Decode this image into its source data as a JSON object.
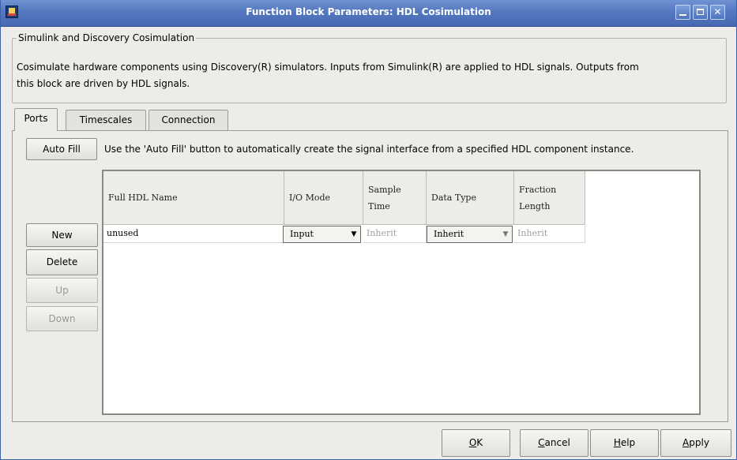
{
  "window": {
    "title": "Function Block Parameters: HDL Cosimulation",
    "icon": "matlab-app-icon",
    "controls": [
      "minimize-icon",
      "maximize-icon",
      "close-icon"
    ]
  },
  "group": {
    "title": "Simulink and Discovery Cosimulation",
    "description_line1": "Cosimulate hardware components using Discovery(R) simulators. Inputs from Simulink(R) are applied to HDL signals. Outputs from",
    "description_line2": "this block are driven by HDL signals."
  },
  "tabs": [
    {
      "label": "Ports",
      "active": true
    },
    {
      "label": "Timescales",
      "active": false
    },
    {
      "label": "Connection",
      "active": false
    }
  ],
  "ports": {
    "autofill_label": "Auto Fill",
    "autofill_hint": "Use the 'Auto Fill' button to automatically create the signal interface from a specified HDL component instance.",
    "side_buttons": {
      "new": "New",
      "delete": "Delete",
      "up": "Up",
      "down": "Down"
    },
    "columns": {
      "full_hdl_name": "Full HDL Name",
      "io_mode": "I/O Mode",
      "sample_time_1": "Sample",
      "sample_time_2": "Time",
      "data_type": "Data Type",
      "fraction_length_1": "Fraction",
      "fraction_length_2": "Length"
    },
    "rows": [
      {
        "full_hdl_name": "unused",
        "io_mode": "Input",
        "sample_time": "Inherit",
        "data_type": "Inherit",
        "fraction_length": "Inherit"
      }
    ]
  },
  "footer": {
    "ok_pre": "",
    "ok_u": "O",
    "ok_post": "K",
    "cancel_pre": "",
    "cancel_u": "C",
    "cancel_post": "ancel",
    "help_pre": "",
    "help_u": "H",
    "help_post": "elp",
    "apply_pre": "",
    "apply_u": "A",
    "apply_post": "pply"
  },
  "colors": {
    "titlebar": "#5478bf",
    "dialog_bg": "#edece8"
  }
}
